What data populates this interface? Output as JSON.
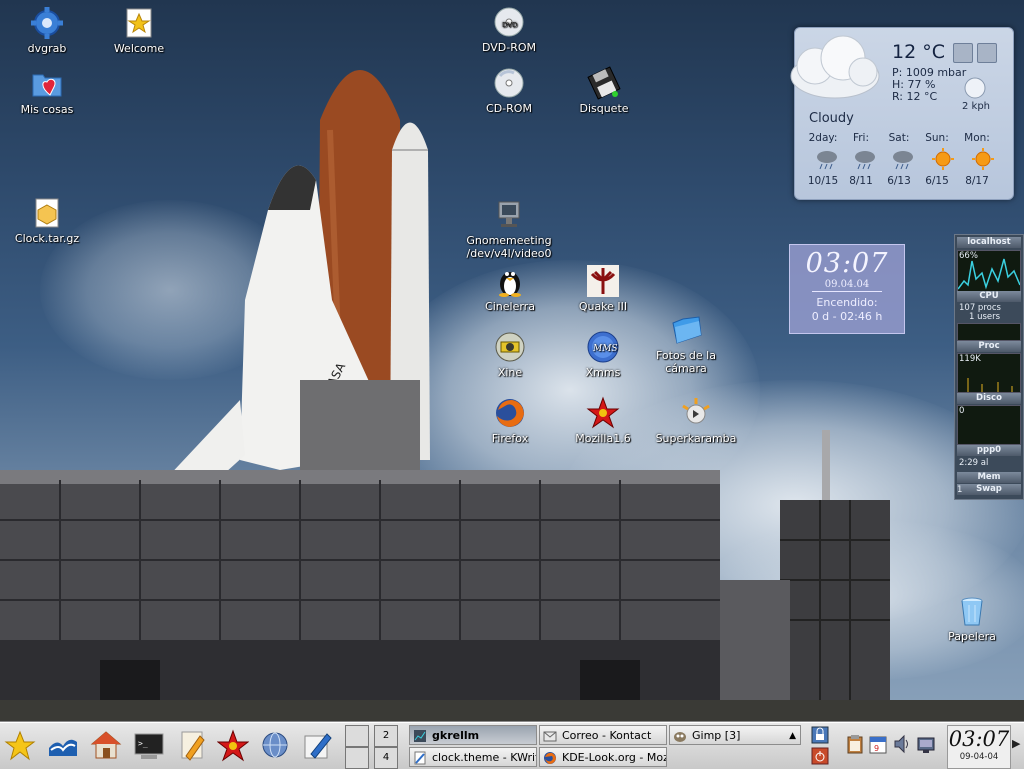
{
  "desktop": {
    "icons": [
      {
        "id": "dvgrab",
        "label": "dvgrab",
        "icon": "gear-icon"
      },
      {
        "id": "welcome",
        "label": "Welcome",
        "icon": "star-document-icon"
      },
      {
        "id": "mis_cosas",
        "label": "Mis cosas",
        "icon": "heart-folder-icon"
      },
      {
        "id": "clock_tar",
        "label": "Clock.tar.gz",
        "icon": "archive-icon"
      },
      {
        "id": "dvd_rom",
        "label": "DVD-ROM",
        "icon": "dvd-icon"
      },
      {
        "id": "cd_rom",
        "label": "CD-ROM",
        "icon": "cd-icon"
      },
      {
        "id": "disquete",
        "label": "Disquete",
        "icon": "floppy-icon"
      },
      {
        "id": "gnomemeeting",
        "label": "Gnomemeeting\n/dev/v4l/video0",
        "icon": "webcam-icon"
      },
      {
        "id": "cinelerra",
        "label": "Cinelerra",
        "icon": "tux-icon"
      },
      {
        "id": "quake",
        "label": "Quake III",
        "icon": "quake-icon"
      },
      {
        "id": "xine",
        "label": "Xine",
        "icon": "xine-icon"
      },
      {
        "id": "xmms",
        "label": "Xmms",
        "icon": "xmms-icon"
      },
      {
        "id": "fotos",
        "label": "Fotos de la\ncámara",
        "icon": "folder-icon"
      },
      {
        "id": "firefox",
        "label": "Firefox",
        "icon": "firefox-icon"
      },
      {
        "id": "mozilla",
        "label": "Mozilla1.6",
        "icon": "mozilla-star-icon"
      },
      {
        "id": "superkaramba",
        "label": "Superkaramba",
        "icon": "superkaramba-icon"
      },
      {
        "id": "papelera",
        "label": "Papelera",
        "icon": "trash-icon"
      }
    ]
  },
  "weather": {
    "temp": "12 °C",
    "pressure": "P: 1009 mbar",
    "humidity": "H: 77 %",
    "realfeel": "R: 12 °C",
    "wind": "2 kph",
    "condition": "Cloudy",
    "forecast": [
      {
        "day": "2day:",
        "range": "10/15",
        "icon": "rain-cloud-icon"
      },
      {
        "day": "Fri:",
        "range": "8/11",
        "icon": "rain-cloud-icon"
      },
      {
        "day": "Sat:",
        "range": "6/13",
        "icon": "rain-cloud-icon"
      },
      {
        "day": "Sun:",
        "range": "6/15",
        "icon": "sun-icon"
      },
      {
        "day": "Mon:",
        "range": "8/17",
        "icon": "sun-icon"
      }
    ]
  },
  "clock_widget": {
    "time": "03:07",
    "date": "09.04.04",
    "uptime_label": "Encendido:",
    "uptime": "0 d - 02:46 h"
  },
  "gkrellm": {
    "host": "localhost",
    "cpu_pct": "66%",
    "cpu_label": "CPU",
    "procs": "107 procs",
    "users": "1 users",
    "proc_label": "Proc",
    "proc_val": "119K",
    "disk_label": "Disco",
    "disk_val": "0",
    "net_label": "ppp0",
    "net_time": "2:29 al",
    "mem_label": "Mem",
    "swap_label": "Swap",
    "load": "1"
  },
  "taskbar": {
    "quicklaunch": [
      {
        "name": "kde-menu",
        "icon": "kde-star-icon"
      },
      {
        "name": "openoffice",
        "icon": "seagull-icon"
      },
      {
        "name": "home",
        "icon": "home-icon"
      },
      {
        "name": "terminal",
        "icon": "terminal-icon"
      },
      {
        "name": "editor",
        "icon": "editor-icon"
      },
      {
        "name": "mozilla",
        "icon": "mozilla-star-icon"
      },
      {
        "name": "network",
        "icon": "globe-icon"
      },
      {
        "name": "kwrite",
        "icon": "pen-icon"
      }
    ],
    "pager": [
      "2",
      "4"
    ],
    "tasks": [
      {
        "label": "gkrellm",
        "icon": "gkrellm-icon",
        "active": true
      },
      {
        "label": "Correo - Kontact",
        "icon": "mail-icon",
        "active": false
      },
      {
        "label": "Gimp [3]",
        "icon": "gimp-icon",
        "active": false
      },
      {
        "label": "clock.theme - KWrite",
        "icon": "kwrite-icon",
        "active": false
      },
      {
        "label": "KDE-Look.org - Mozilla",
        "icon": "firefox-icon",
        "active": false
      }
    ],
    "tray": [
      {
        "name": "lock",
        "icon": "lock-icon"
      },
      {
        "name": "logout",
        "icon": "power-icon"
      },
      {
        "name": "klipper",
        "icon": "clipboard-icon"
      },
      {
        "name": "kmix-task",
        "icon": "calendar-icon"
      },
      {
        "name": "volume",
        "icon": "speaker-icon"
      },
      {
        "name": "network-tray",
        "icon": "network-icon"
      }
    ],
    "clock_time": "03:07",
    "clock_date": "09-04-04"
  }
}
